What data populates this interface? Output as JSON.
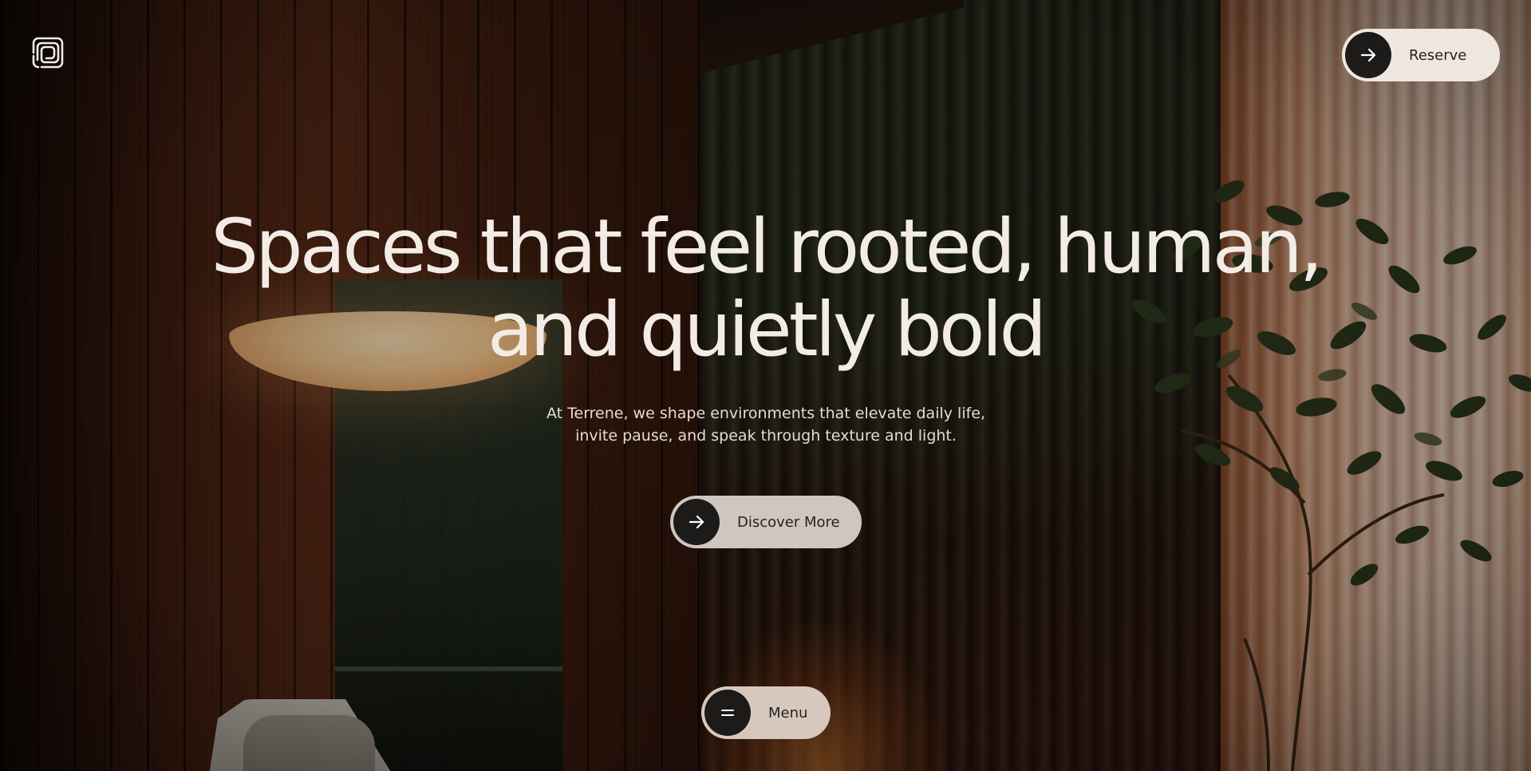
{
  "header": {
    "logo_icon": "spiral-square-logo-icon",
    "reserve": {
      "label": "Reserve",
      "icon": "arrow-right-icon"
    }
  },
  "hero": {
    "headline_line1": "Spaces that feel rooted, human,",
    "headline_line2": "and quietly bold",
    "subtext_line1": "At Terrene, we shape environments that elevate daily life,",
    "subtext_line2": "invite pause, and speak through texture and light.",
    "cta": {
      "label": "Discover More",
      "icon": "arrow-right-icon"
    }
  },
  "menu_button": {
    "label": "Menu",
    "icon": "menu-icon"
  },
  "colors": {
    "pill_reserve": "#efe6df",
    "pill_discover": "#cfc6bf",
    "pill_menu": "#d7c8be",
    "circle_dark": "#1c1b1a",
    "headline_text": "#f3ece6"
  }
}
